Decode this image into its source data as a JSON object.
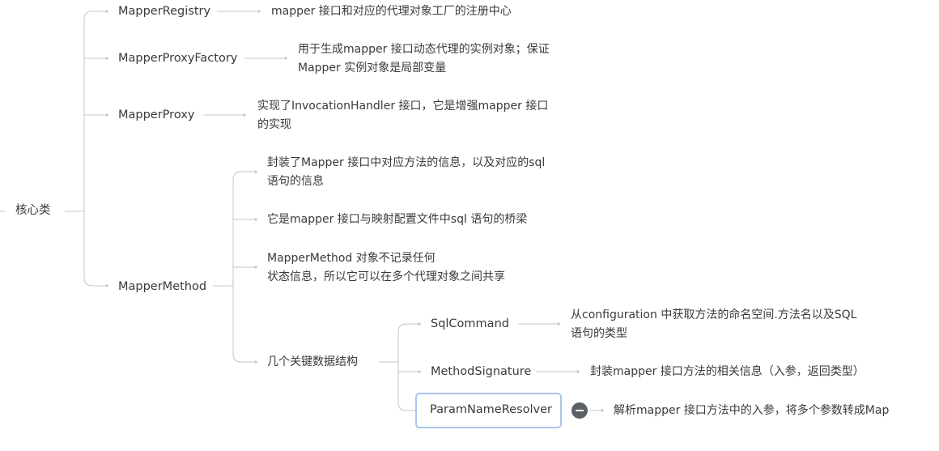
{
  "mindmap": {
    "root": {
      "label": "核心类"
    },
    "mapper_registry": {
      "label": "MapperRegistry",
      "desc": "mapper 接口和对应的代理对象工厂的注册中心"
    },
    "mapper_proxy_factory": {
      "label": "MapperProxyFactory",
      "desc_line1": "用于生成mapper 接口动态代理的实例对象；保证",
      "desc_line2": "Mapper 实例对象是局部变量"
    },
    "mapper_proxy": {
      "label": "MapperProxy",
      "desc_line1": "实现了InvocationHandler 接口，它是增强mapper 接口",
      "desc_line2": "的实现"
    },
    "mapper_method": {
      "label": "MapperMethod",
      "child1_line1": "封装了Mapper 接口中对应方法的信息，以及对应的sql",
      "child1_line2": "语句的信息",
      "child2": "它是mapper 接口与映射配置文件中sql 语句的桥梁",
      "child3_line1": "MapperMethod 对象不记录任何",
      "child3_line2": "状态信息，所以它可以在多个代理对象之间共享",
      "key_structures": {
        "label": "几个关键数据结构",
        "sql_command": {
          "label": "SqlCommand",
          "desc_line1": "从configuration 中获取方法的命名空间.方法名以及SQL",
          "desc_line2": "语句的类型"
        },
        "method_signature": {
          "label": "MethodSignature",
          "desc": "封装mapper 接口方法的相关信息（入参，返回类型）"
        },
        "param_name_resolver": {
          "label": "ParamNameResolver",
          "desc": "解析mapper 接口方法中的入参，将多个参数转成Map"
        }
      }
    }
  }
}
